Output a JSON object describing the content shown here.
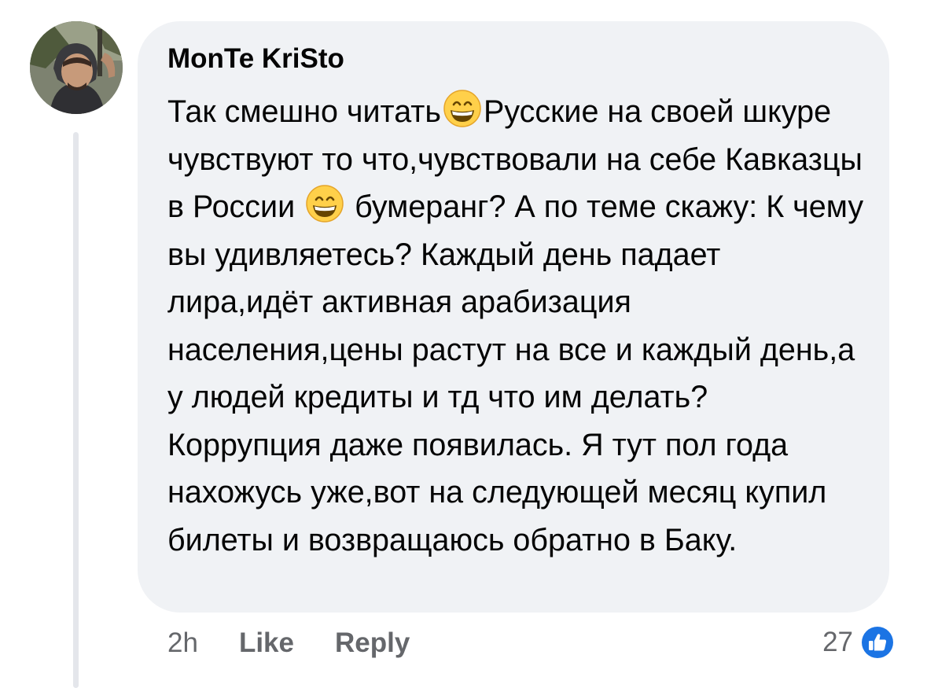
{
  "comment": {
    "author": "MonTe KriSto",
    "avatar_icon": "user-photo-avatar",
    "text_parts": [
      "Так смешно читать",
      "Русские на своей шкуре чувствуют то что,чувствовали на себе Кавказцы в России ",
      " бумеранг? А по теме скажу: К чему вы удивляетесь? Каждый день падает лира,идёт активная арабизация населения,цены растут на все и каждый день,а у людей кредиты и тд что им делать? Коррупция даже появилась. Я тут пол года нахожусь уже,вот на следующей месяц купил билеты и возвращаюсь обратно в Баку."
    ],
    "emoji_icon": "grinning-face-with-smiling-eyes-icon"
  },
  "actions": {
    "time": "2h",
    "like_label": "Like",
    "reply_label": "Reply"
  },
  "reactions": {
    "count": "27",
    "icon": "thumbs-up-icon"
  },
  "colors": {
    "bubble_bg": "#f0f2f5",
    "secondary_text": "#65676b",
    "like_blue": "#1b74e4",
    "thread_line": "#e4e6eb"
  }
}
